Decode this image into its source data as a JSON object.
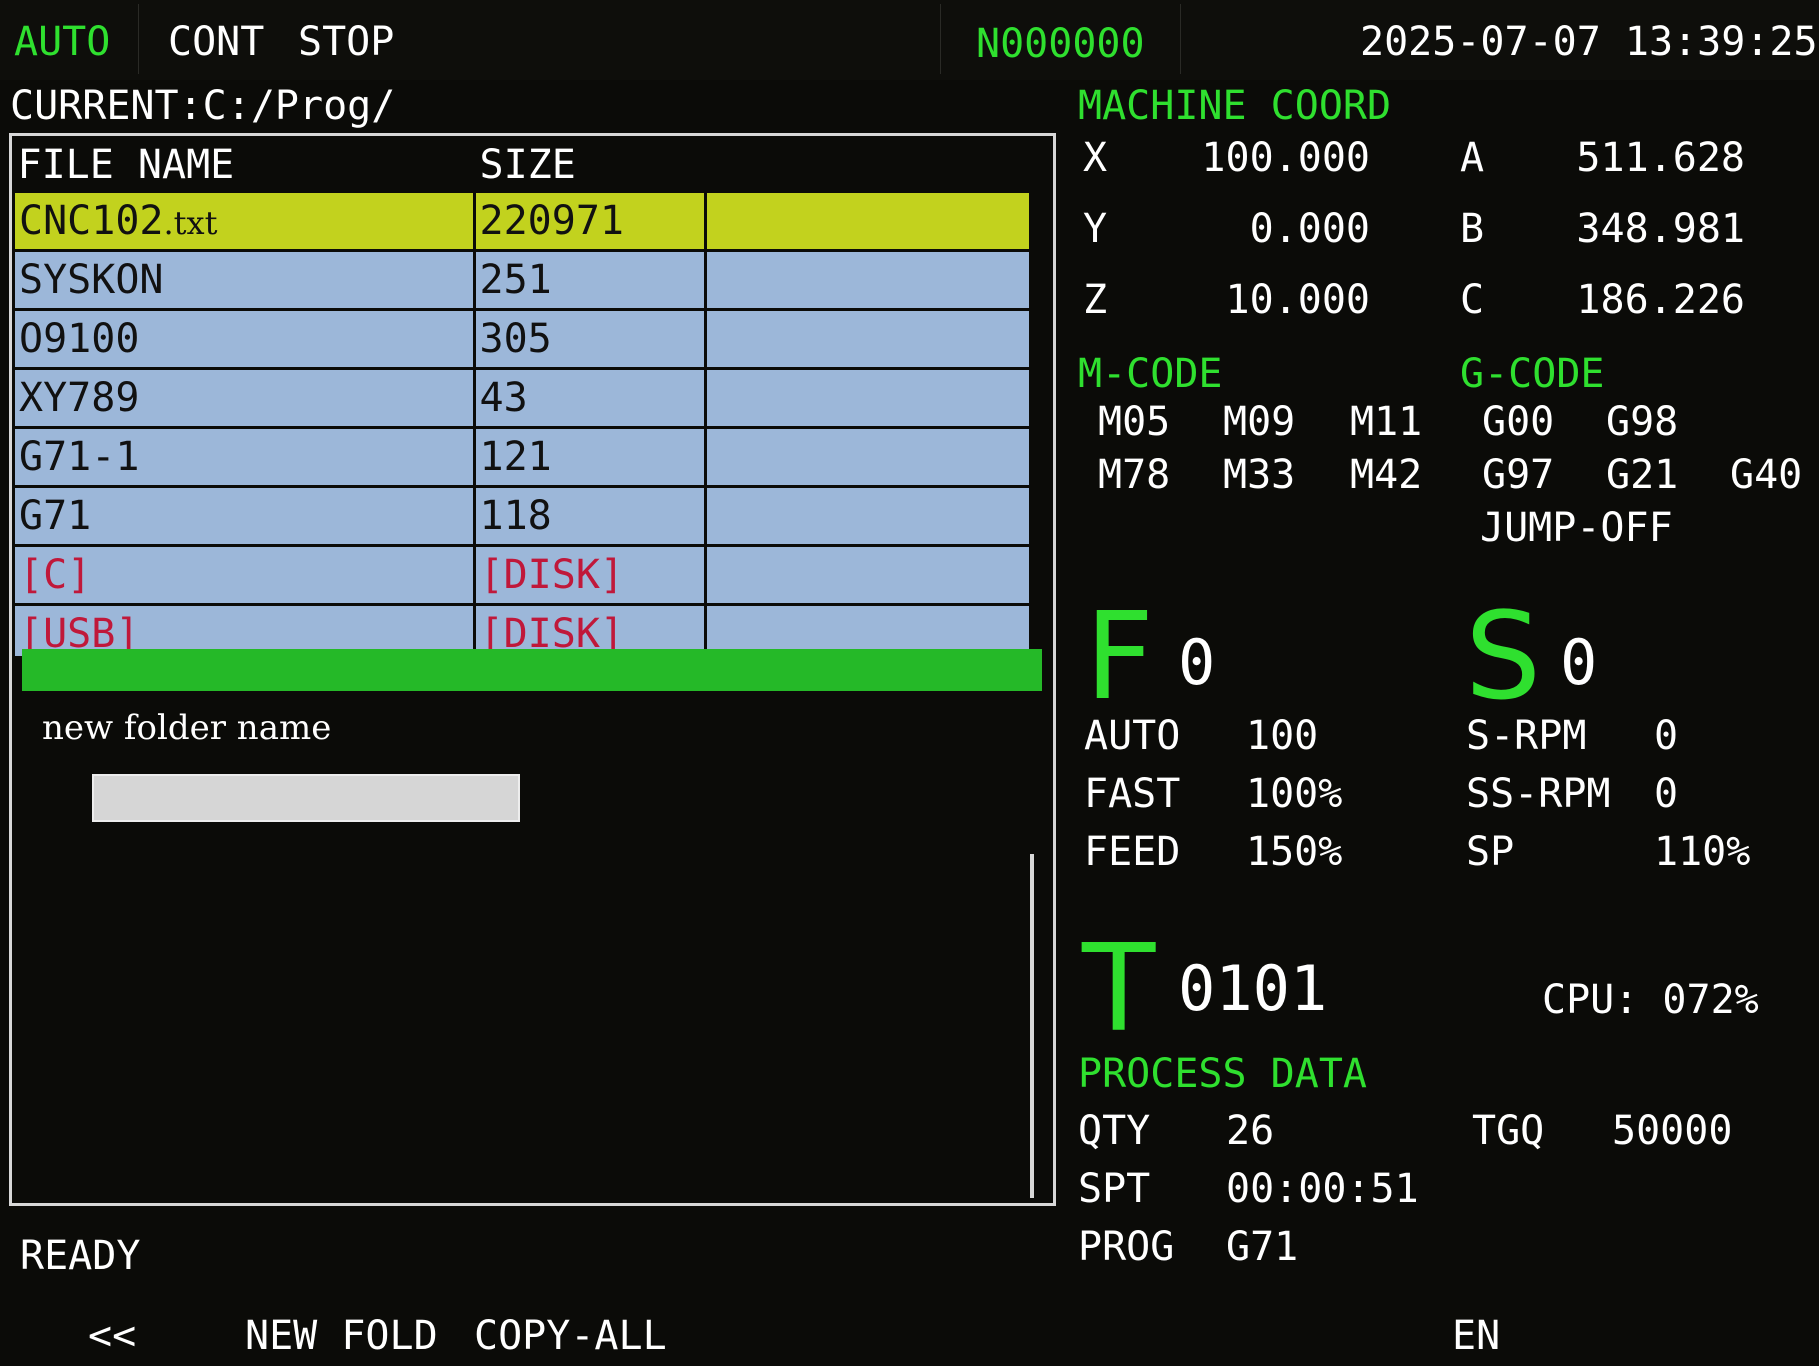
{
  "status_bar": {
    "mode": "AUTO",
    "cont": "CONT",
    "stop": "STOP",
    "block_number": "N000000",
    "datetime": "2025-07-07 13:39:25"
  },
  "file_browser": {
    "current_path": "CURRENT:C:/Prog/",
    "columns": [
      "FILE NAME",
      "SIZE"
    ],
    "rows": [
      {
        "name": "CNC102",
        "ext": ".txt",
        "size": "220971",
        "selected": true
      },
      {
        "name": "SYSKON",
        "ext": "",
        "size": "251"
      },
      {
        "name": "O9100",
        "ext": "",
        "size": "305"
      },
      {
        "name": "XY789",
        "ext": "",
        "size": "43"
      },
      {
        "name": "G71-1",
        "ext": "",
        "size": "121"
      },
      {
        "name": "G71",
        "ext": "",
        "size": "118"
      },
      {
        "name": "[C]",
        "ext": "",
        "size": "[DISK]",
        "drive": true
      },
      {
        "name": "[USB]",
        "ext": "",
        "size": "[DISK]",
        "drive": true
      }
    ]
  },
  "new_folder_dialog": {
    "label": "new folder name",
    "value": ""
  },
  "machine_coord": {
    "title": "MACHINE COORD",
    "axes": [
      {
        "axis": "X",
        "value": "100.000"
      },
      {
        "axis": "Y",
        "value": "0.000"
      },
      {
        "axis": "Z",
        "value": "10.000"
      },
      {
        "axis": "A",
        "value": "511.628"
      },
      {
        "axis": "B",
        "value": "348.981"
      },
      {
        "axis": "C",
        "value": "186.226"
      }
    ]
  },
  "m_code": {
    "title": "M-CODE",
    "codes": [
      "M05",
      "M09",
      "M11",
      "M78",
      "M33",
      "M42"
    ]
  },
  "g_code": {
    "title": "G-CODE",
    "codes": [
      "G00",
      "G98",
      "G97",
      "G21",
      "G40"
    ],
    "extra": "JUMP-OFF"
  },
  "feed_spindle": {
    "f_letter": "F",
    "f_value": "0",
    "s_letter": "S",
    "s_value": "0",
    "left": [
      {
        "label": "AUTO",
        "value": "100"
      },
      {
        "label": "FAST",
        "value": "100%"
      },
      {
        "label": "FEED",
        "value": "150%"
      }
    ],
    "right": [
      {
        "label": "S-RPM",
        "value": "0"
      },
      {
        "label": "SS-RPM",
        "value": "0"
      },
      {
        "label": "SP",
        "value": "110%"
      }
    ]
  },
  "tool": {
    "t_letter": "T",
    "t_value": "0101",
    "cpu": "CPU: 072%"
  },
  "process_data": {
    "title": "PROCESS DATA",
    "qty_label": "QTY",
    "qty_value": "26",
    "tgq_label": "TGQ",
    "tgq_value": "50000",
    "spt_label": "SPT",
    "spt_value": "00:00:51",
    "prog_label": "PROG",
    "prog_value": "G71"
  },
  "footer": {
    "status": "READY",
    "softkeys": [
      "<<",
      "NEW FOLD",
      "COPY-ALL"
    ],
    "language": "EN"
  },
  "colors": {
    "accent_green": "#2fe02f",
    "row_blue": "#9cb7d9",
    "row_selected": "#c2d21e",
    "drive_text": "#c0183a",
    "background": "#0b0b08"
  }
}
